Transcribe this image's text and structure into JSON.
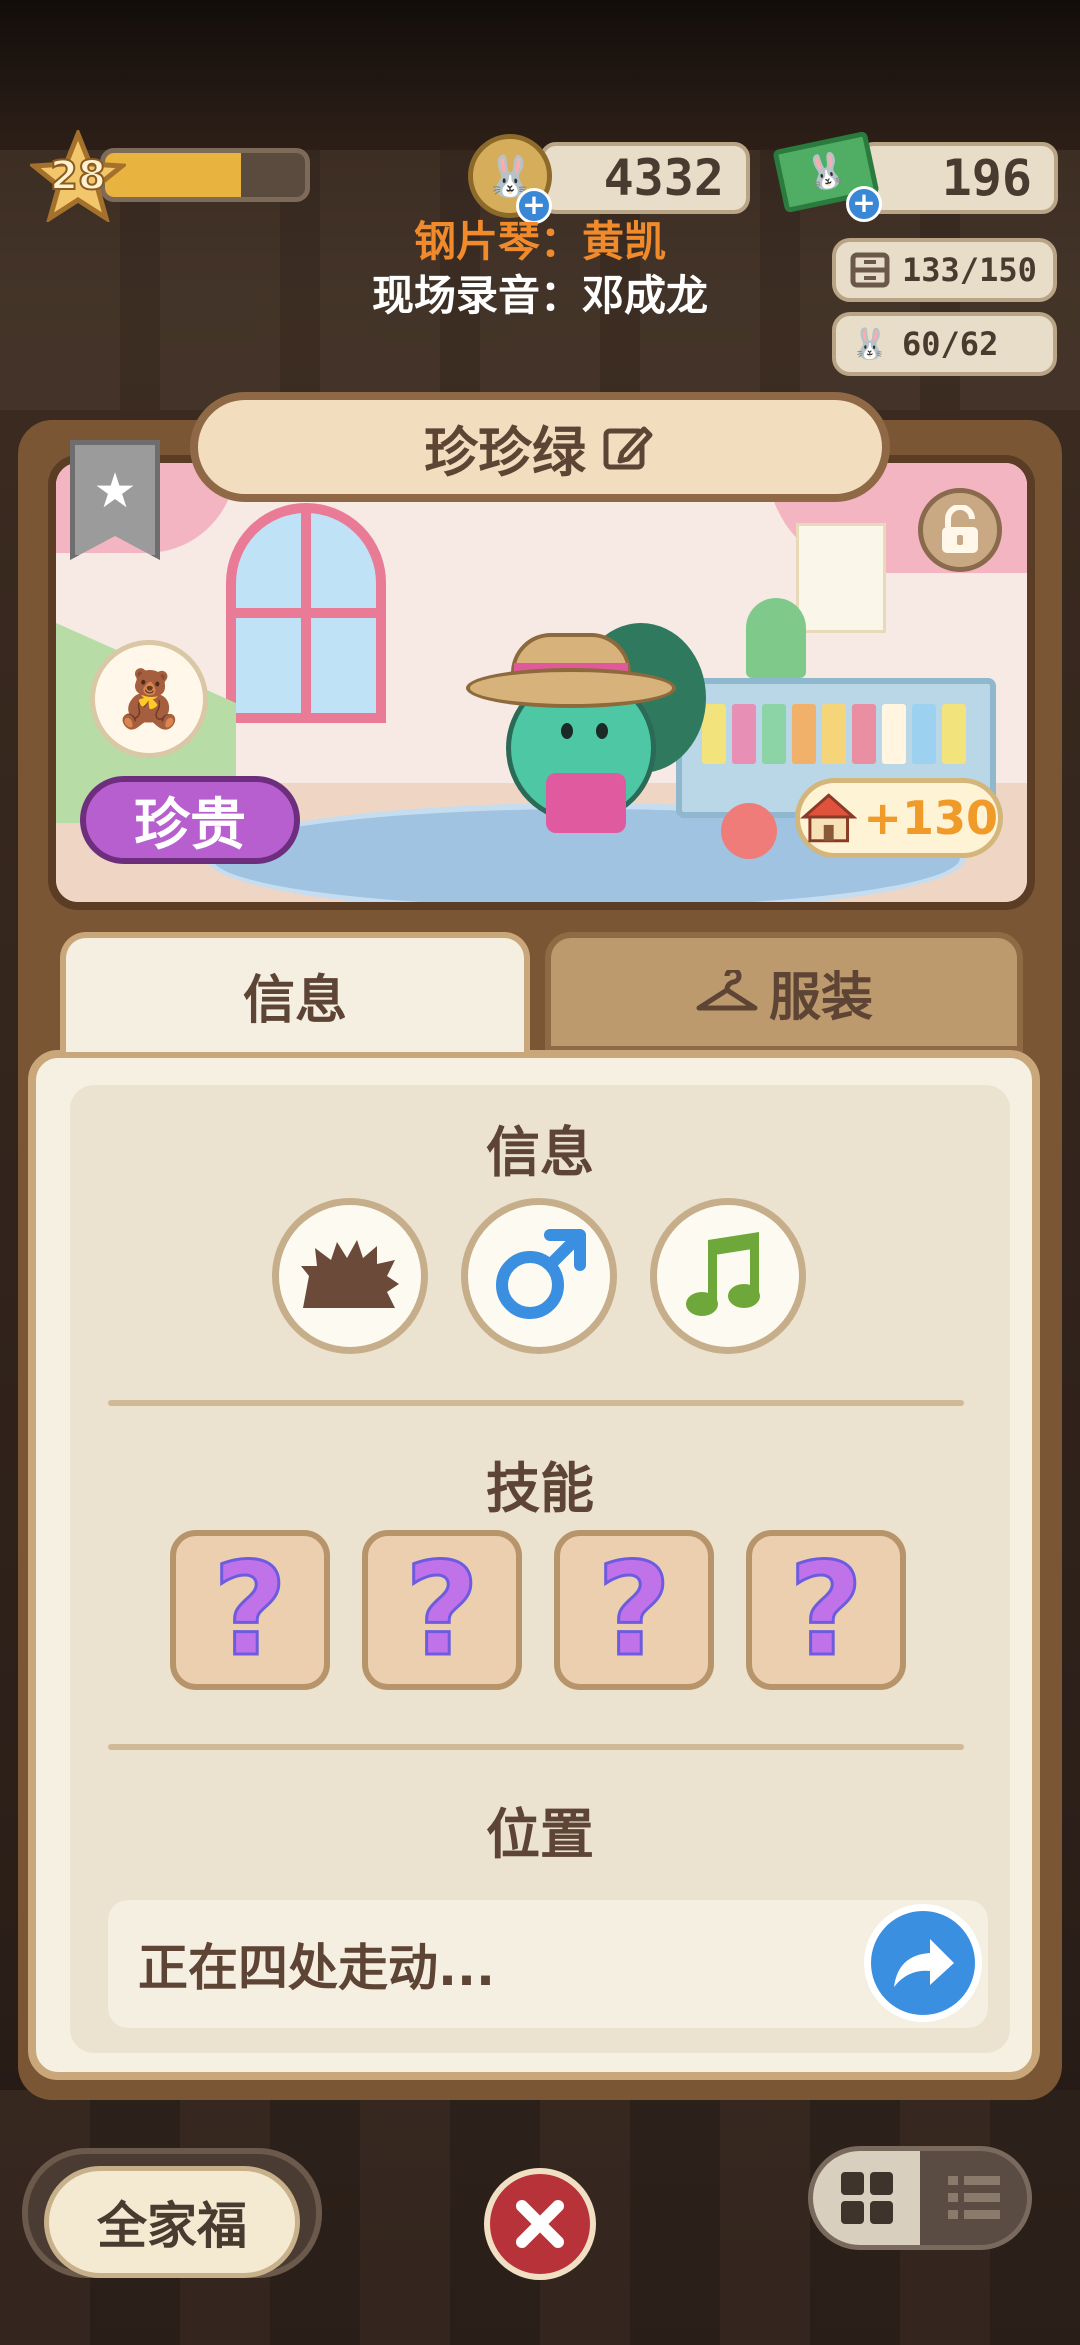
{
  "hud": {
    "level": "28",
    "level_progress": 0.68,
    "coins": "4332",
    "cash": "196",
    "storage": "133/150",
    "residents": "60/62"
  },
  "credits": {
    "line1": "钢片琴：黄凯",
    "line2": "现场录音：邓成龙"
  },
  "character": {
    "name": "珍珍绿",
    "rarity": "珍贵",
    "home_bonus": "+130"
  },
  "tabs": [
    {
      "label": "信息",
      "active": true
    },
    {
      "label": "服装",
      "active": false
    }
  ],
  "info": {
    "section_title": "信息",
    "traits": [
      "hedgehog-icon",
      "male-icon",
      "music-note-icon"
    ]
  },
  "skills": {
    "section_title": "技能",
    "slots": [
      "?",
      "?",
      "?",
      "?"
    ]
  },
  "location": {
    "section_title": "位置",
    "status": "正在四处走动..."
  },
  "bottom": {
    "family_label": "全家福"
  },
  "colors": {
    "panel": "#f6f0e2",
    "rarity_purple": "#b85fcf",
    "accent_orange": "#f08a2b",
    "share_blue": "#3b8fe0",
    "close_red": "#b8323a"
  }
}
